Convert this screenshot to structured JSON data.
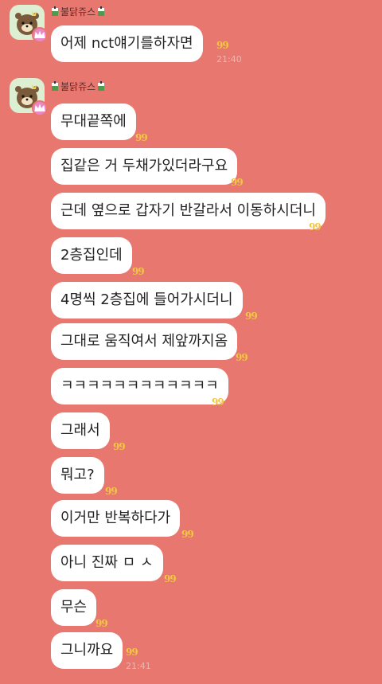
{
  "groups": [
    {
      "sender": "불닭쥬스",
      "messages": [
        {
          "text": "어제 nct얘기를하자면",
          "time": "21:40"
        }
      ]
    },
    {
      "sender": "불닭쥬스",
      "messages": [
        {
          "text": "무대끝쪽에"
        },
        {
          "text": "집같은 거 두채가있더라구요"
        },
        {
          "text": "근데 옆으로 갑자기 반갈라서 이동하시더니"
        },
        {
          "text": "2층집인데"
        },
        {
          "text": "4명씩 2층집에 들어가시더니"
        },
        {
          "text": "그대로 움직여서 제앞까지옴"
        },
        {
          "text": "ㅋㅋㅋㅋㅋㅋㅋㅋㅋㅋㅋㅋ"
        },
        {
          "text": "그래서"
        },
        {
          "text": "뭐고?"
        },
        {
          "text": "이거만 반복하다가"
        },
        {
          "text": "아니 진짜 ㅁ ㅅ"
        },
        {
          "text": "무슨"
        },
        {
          "text": "그니까요",
          "time": "21:41"
        }
      ]
    }
  ],
  "unread_mark": "99",
  "colors": {
    "background": "#E8786F",
    "bubble": "#FFFFFF",
    "mark": "#F3C646"
  },
  "icons": {
    "avatar": "kakao-character-icon",
    "badge": "crown-icon",
    "decor": "juice-box-icon"
  }
}
